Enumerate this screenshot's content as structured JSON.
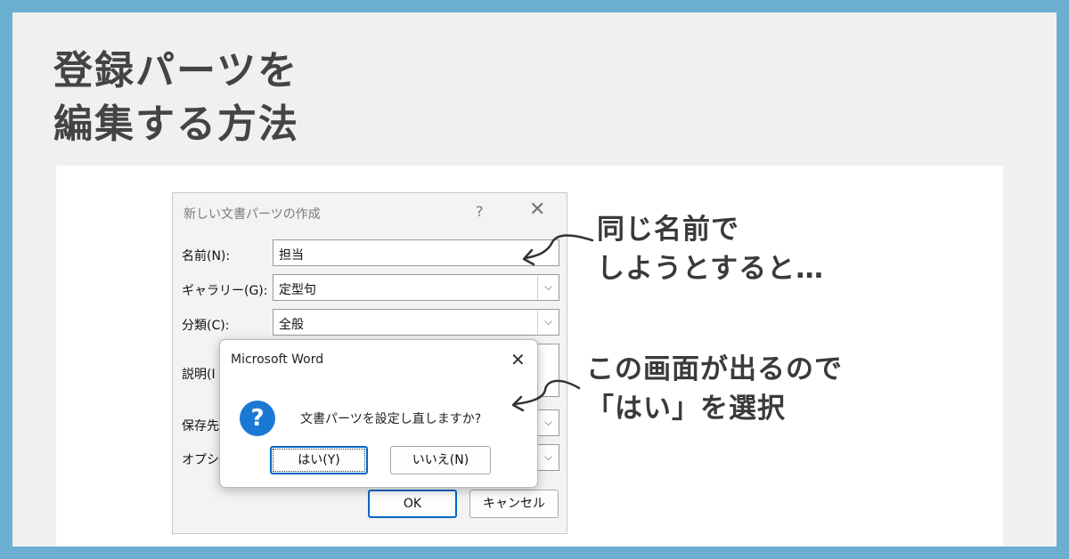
{
  "page": {
    "title_lines": [
      "登録パーツを",
      "編集する方法"
    ]
  },
  "dialog": {
    "title": "新しい文書パーツの作成",
    "help": "?",
    "close": "✕",
    "name_label": "名前(N):",
    "name_value": "担当",
    "gallery_label": "ギャラリー(G):",
    "gallery_value": "定型句",
    "category_label": "分類(C):",
    "category_value": "全般",
    "description_label": "説明(I",
    "save_label": "保存先",
    "options_label": "オプショ",
    "ok": "OK",
    "cancel": "キャンセル"
  },
  "popup": {
    "title": "Microsoft Word",
    "close": "✕",
    "icon": "?",
    "message": "文書パーツを設定し直しますか?",
    "yes_label": "はい(Y)",
    "no_label": "いいえ(N)"
  },
  "annotations": {
    "first_lines": [
      "同じ名前で",
      "しようとすると…"
    ],
    "second_lines": [
      "この画面が出るので",
      "「はい」を選択"
    ]
  },
  "colors": {
    "background_frame": "#6aafd0",
    "card": "#f0f0f0",
    "accent_blue": "#0067c0",
    "question_icon": "#1a79d4"
  }
}
